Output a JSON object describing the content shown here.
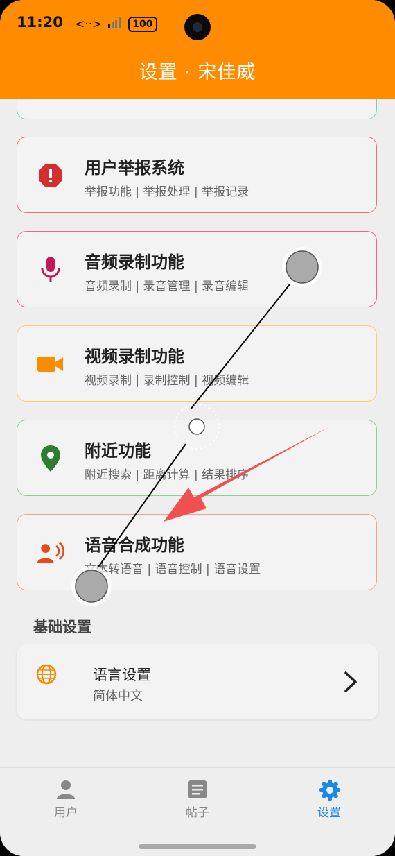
{
  "status_bar": {
    "time": "11:20",
    "signal_text": "<··>",
    "battery": "100"
  },
  "header": {
    "title": "设置 · 宋佳威"
  },
  "feature_cards": [
    {
      "title": "用户举报系统",
      "subtitle": "举报功能 | 举报处理 | 举报记录",
      "icon": "report-icon",
      "accent": "#e57373",
      "icon_color": "#d32f2f"
    },
    {
      "title": "音频录制功能",
      "subtitle": "音频录制 | 录音管理 | 录音编辑",
      "icon": "microphone-icon",
      "accent": "#f06292",
      "icon_color": "#c2185b"
    },
    {
      "title": "视频录制功能",
      "subtitle": "视频录制 | 录制控制 | 视频编辑",
      "icon": "video-camera-icon",
      "accent": "#ffcc66",
      "icon_color": "#fb8c00"
    },
    {
      "title": "附近功能",
      "subtitle": "附近搜索 | 距离计算 | 结果排序",
      "icon": "location-pin-icon",
      "accent": "#8fcf92",
      "icon_color": "#2e7d32"
    },
    {
      "title": "语音合成功能",
      "subtitle": "文本转语音 | 语音控制 | 语音设置",
      "icon": "voice-speaker-icon",
      "accent": "#ff9e80",
      "icon_color": "#e64a19"
    }
  ],
  "basic_settings": {
    "section_title": "基础设置",
    "language": {
      "title": "语言设置",
      "value": "简体中文"
    }
  },
  "bottom_nav": [
    {
      "label": "用户",
      "icon": "person-icon",
      "active": false
    },
    {
      "label": "帖子",
      "icon": "article-icon",
      "active": false
    },
    {
      "label": "设置",
      "icon": "gear-icon",
      "active": true
    }
  ],
  "colors": {
    "header": "#ff8c00",
    "active_nav": "#1e88e5"
  }
}
